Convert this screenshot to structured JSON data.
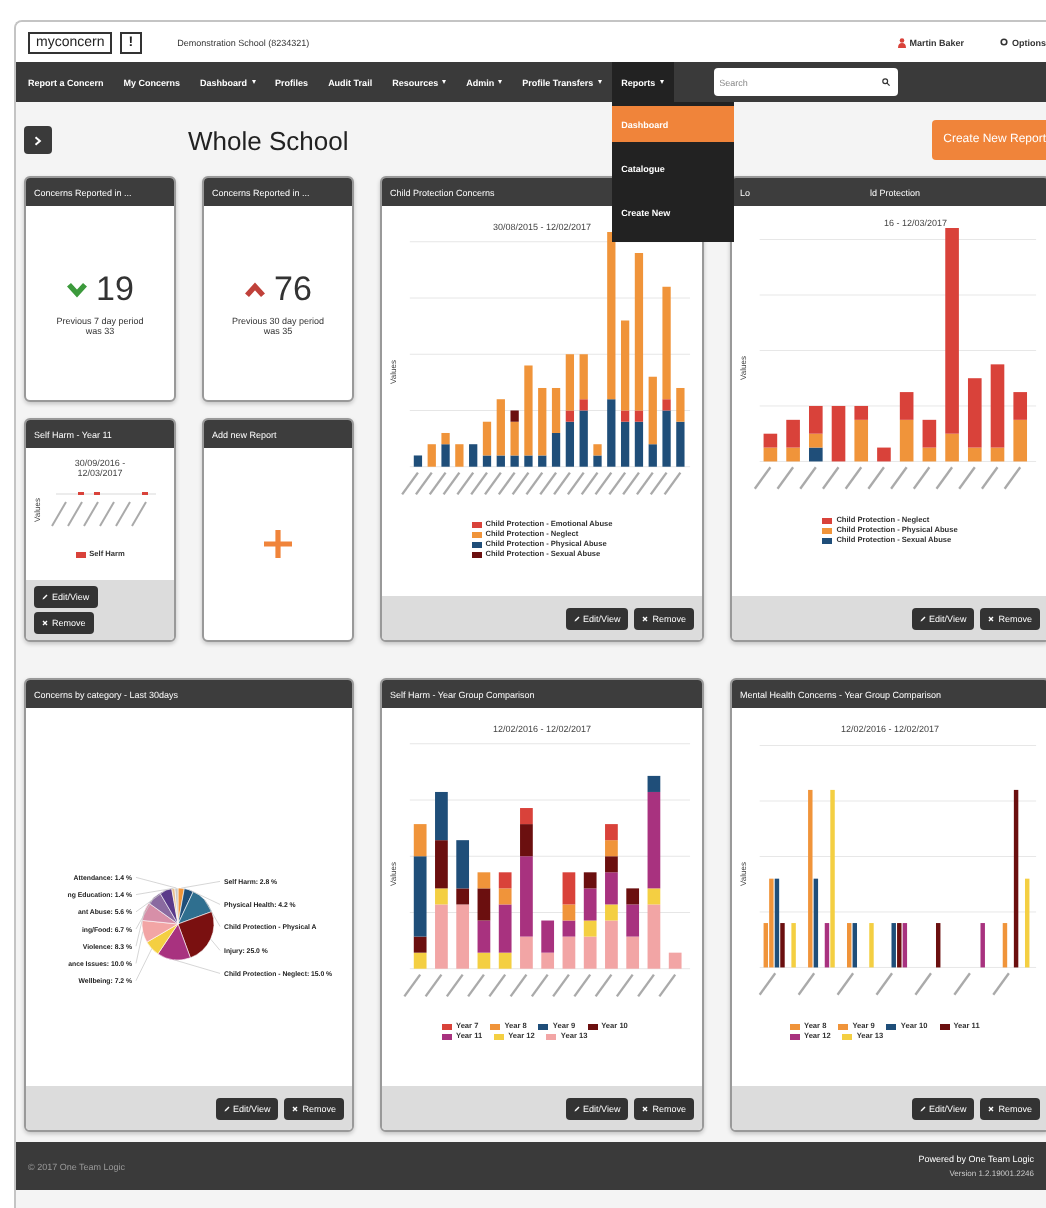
{
  "header": {
    "logo_text": "myconcern",
    "logo_mark": "!",
    "school": "Demonstration School (8234321)",
    "user": "Martin Baker",
    "options": "Options"
  },
  "nav": [
    {
      "label": "Report a Concern",
      "dropdown": false,
      "selected": false
    },
    {
      "label": "My Concerns",
      "dropdown": false,
      "selected": false
    },
    {
      "label": "Dashboard",
      "dropdown": true,
      "selected": false
    },
    {
      "label": "Profiles",
      "dropdown": false,
      "selected": false
    },
    {
      "label": "Audit Trail",
      "dropdown": false,
      "selected": false
    },
    {
      "label": "Resources",
      "dropdown": true,
      "selected": false
    },
    {
      "label": "Admin",
      "dropdown": true,
      "selected": false
    },
    {
      "label": "Profile Transfers",
      "dropdown": true,
      "selected": false
    },
    {
      "label": "Reports",
      "dropdown": true,
      "selected": true
    }
  ],
  "reports_menu": [
    {
      "label": "Dashboard",
      "selected": true
    },
    {
      "label": "Catalogue",
      "selected": false
    },
    {
      "label": "Create New",
      "selected": false
    }
  ],
  "search": {
    "placeholder": "Search"
  },
  "page_title": "Whole School",
  "create_button": "Create New Report",
  "panels": [
    {
      "kind": "stat",
      "title": "Concerns Reported in ...",
      "rising": false,
      "value": "19",
      "caption": "Previous 7 day period was 33"
    },
    {
      "kind": "stat",
      "title": "Concerns Reported in ...",
      "rising": true,
      "value": "76",
      "caption": "Previous 30 day period was 35"
    },
    {
      "kind": "bar_chart",
      "title": "Child Protection Concerns",
      "date": "30/08/2015 - 12/02/2017",
      "ylabel": "Values",
      "legend": [
        {
          "label": "Child Protection - Emotional Abuse",
          "color": "#d9423a"
        },
        {
          "label": "Child Protection - Neglect",
          "color": "#f0943a"
        },
        {
          "label": "Child Protection - Physical Abuse",
          "color": "#1f4e79"
        },
        {
          "label": "Child Protection - Sexual Abuse",
          "color": "#6b0f0f"
        }
      ],
      "buttons": [
        {
          "label": "Edit/View",
          "kind": "edit"
        },
        {
          "label": "Remove",
          "kind": "remove"
        }
      ]
    },
    {
      "kind": "bar_chart",
      "title_parts": [
        "Lo",
        "ld Protection"
      ],
      "date": "16 - 12/03/2017",
      "ylabel": "Values",
      "legend": [
        {
          "label": "Child Protection - Neglect",
          "color": "#d9423a"
        },
        {
          "label": "Child Protection - Physical Abuse",
          "color": "#f0943a"
        },
        {
          "label": "Child Protection - Sexual Abuse",
          "color": "#1f4e79"
        }
      ],
      "buttons": [
        {
          "label": "Edit/View",
          "kind": "edit"
        },
        {
          "label": "Remove",
          "kind": "remove"
        }
      ]
    },
    {
      "kind": "mini_chart",
      "title": "Self Harm - Year 11",
      "date": "30/09/2016 - 12/03/2017",
      "ylabel": "Values",
      "legend": [
        {
          "label": "Self Harm",
          "color": "#d9423a"
        }
      ],
      "buttons": [
        {
          "label": "Edit/View",
          "kind": "edit"
        },
        {
          "label": "Remove",
          "kind": "remove"
        }
      ]
    },
    {
      "kind": "add",
      "title": "Add new Report"
    },
    {
      "kind": "pie_chart",
      "title": "Concerns by category - Last 30days",
      "slice_labels": [
        "Attendance: 1.4 %",
        "Self Harm: 2.8 %",
        "ng Education: 1.4 %",
        "Physical Health: 4.2 %",
        "ant Abuse: 5.6 %",
        "Child Protection - Physical A",
        "ing/Food: 6.7 %",
        "Violence: 8.3 %",
        "Injury: 25.0 %",
        "ance Issues: 10.0 %",
        "Child Protection - Neglect: 15.0 %",
        "Wellbeing: 7.2 %"
      ],
      "buttons": [
        {
          "label": "Edit/View",
          "kind": "edit"
        },
        {
          "label": "Remove",
          "kind": "remove"
        }
      ]
    },
    {
      "kind": "bar_chart",
      "title": "Self Harm - Year Group Comparison",
      "date": "12/02/2016 - 12/02/2017",
      "ylabel": "Values",
      "legend": [
        {
          "label": "Year 7",
          "color": "#d9423a"
        },
        {
          "label": "Year 8",
          "color": "#f0943a"
        },
        {
          "label": "Year 9",
          "color": "#1f4e79"
        },
        {
          "label": "Year 10",
          "color": "#6b0f0f"
        },
        {
          "label": "Year 11",
          "color": "#a8327f"
        },
        {
          "label": "Year 12",
          "color": "#f4cf42"
        },
        {
          "label": "Year 13",
          "color": "#f2a5a5"
        }
      ],
      "buttons": [
        {
          "label": "Edit/View",
          "kind": "edit"
        },
        {
          "label": "Remove",
          "kind": "remove"
        }
      ]
    },
    {
      "kind": "grouped_bar_chart",
      "title": "Mental Health Concerns - Year Group Comparison",
      "date": "12/02/2016 - 12/02/2017",
      "ylabel": "Values",
      "legend": [
        {
          "label": "Year 8",
          "color": "#f0943a"
        },
        {
          "label": "Year 9",
          "color": "#f0943a"
        },
        {
          "label": "Year 10",
          "color": "#1f4e79"
        },
        {
          "label": "Year 11",
          "color": "#6b0f0f"
        },
        {
          "label": "Year 12",
          "color": "#a8327f"
        },
        {
          "label": "Year 13",
          "color": "#f4cf42"
        }
      ],
      "buttons": [
        {
          "label": "Edit/View",
          "kind": "edit"
        },
        {
          "label": "Remove",
          "kind": "remove"
        }
      ]
    }
  ],
  "footer": {
    "copyright": "© 2017 One Team Logic",
    "powered": "Powered by One Team Logic",
    "version": "Version 1.2.19001.2246"
  }
}
